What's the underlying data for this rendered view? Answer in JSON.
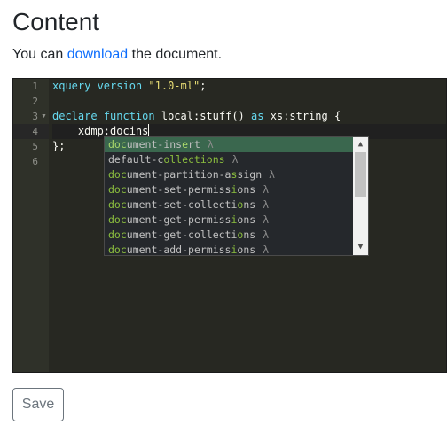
{
  "page": {
    "title": "Content",
    "intro_before": "You can ",
    "intro_link": "download",
    "intro_after": " the document."
  },
  "editor": {
    "line_numbers": [
      "1",
      "2",
      "3",
      "4",
      "5",
      "6"
    ],
    "active_line": 4,
    "lines": {
      "l1_kw": "xquery version",
      "l1_str": "\"1.0-ml\"",
      "l1_end": ";",
      "l3_declare": "declare",
      "l3_function": "function",
      "l3_name": "local:stuff",
      "l3_parens": "()",
      "l3_as": "as",
      "l3_type": "xs:string",
      "l3_brace": "{",
      "l4_text": "    xdmp:docins",
      "l5_text": "};"
    }
  },
  "autocomplete": {
    "items": [
      {
        "p1": "doc",
        "m1": "ument-ins",
        "p2": "e",
        "m2": "rt",
        "rest": "",
        "lambda": "λ"
      },
      {
        "p1": "",
        "m1": "",
        "p2": "default-c",
        "m2": "ollections",
        "rest": "",
        "lambda": "λ"
      },
      {
        "p1": "doc",
        "m1": "ument-partition-a",
        "p2": "s",
        "m2": "sign",
        "rest": "",
        "lambda": "λ"
      },
      {
        "p1": "doc",
        "m1": "ument-set-permiss",
        "p2": "i",
        "m2": "ons",
        "rest": "",
        "lambda": "λ"
      },
      {
        "p1": "doc",
        "m1": "ument-set-collecti",
        "p2": "o",
        "m2": "ns",
        "rest": "",
        "lambda": "λ"
      },
      {
        "p1": "doc",
        "m1": "ument-get-permiss",
        "p2": "i",
        "m2": "ons",
        "rest": "",
        "lambda": "λ"
      },
      {
        "p1": "doc",
        "m1": "ument-get-collecti",
        "p2": "o",
        "m2": "ns",
        "rest": "",
        "lambda": "λ"
      },
      {
        "p1": "doc",
        "m1": "ument-add-permiss",
        "p2": "i",
        "m2": "ons",
        "rest": "",
        "lambda": "λ"
      }
    ],
    "selected_index": 0
  },
  "toolbar": {
    "save_label": "Save"
  },
  "colors": {
    "link": "#0d6efd",
    "editor_bg": "#272822",
    "selected_item": "#3a674e"
  }
}
